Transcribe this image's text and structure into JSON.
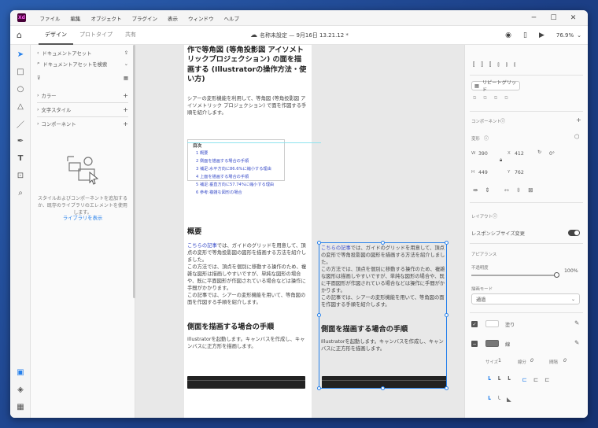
{
  "menubar": {
    "logo": "Xd",
    "items": [
      "ファイル",
      "編集",
      "オブジェクト",
      "プラグイン",
      "表示",
      "ウィンドウ",
      "ヘルプ"
    ],
    "minimize": "─",
    "maximize": "☐",
    "close": "✕"
  },
  "toolbar": {
    "tabs": [
      "デザイン",
      "プロトタイプ",
      "共有"
    ],
    "active_tab": "デザイン",
    "doc_title": "名称未設定 — 9月16日 13.21.12 *",
    "zoom": "76.9%"
  },
  "assets": {
    "title": "ドキュメントアセット",
    "search_placeholder": "ドキュメントアセットを検索",
    "sections": [
      {
        "label": "カラー",
        "add": "+"
      },
      {
        "label": "文字スタイル",
        "add": "+"
      },
      {
        "label": "コンポーネント",
        "add": "+"
      }
    ],
    "hint": "スタイルおよびコンポーネントを追加するか、既存のライブラリのエレメントを使用します。",
    "library_button": "ライブラリを表示"
  },
  "article_left": {
    "title": "シアーの変形機能を利用した変形操作で等角図 (等角投影図 アイソメトリックプロジェクション) の面を描画する (Illustratorの操作方法・使い方)",
    "intro": "シアーの変形機能を利用して、等角図 (等角投影図 アイソメトリック プロジェクション) で面を作図する手順を紹介します。",
    "toc_title": "目次",
    "toc": [
      "1 概要",
      "2 側面を描画する場合の手順",
      "3 補足:水平方向に86.6%に縮小する理由",
      "4 上面を描画する場合の手順",
      "5 補足:垂直方向に57.74%に縮小する理由",
      "6 参考:複雑な図形の場合"
    ],
    "h_overview": "概要",
    "link": "こちらの記事",
    "p1": "では、ガイドのグリッドを用意して、頂点の変形で等角投影図の図形を描画する方法を紹介しました。",
    "p2": "この方法では、頂点を個別に移動する操作のため、複雑な図形は描画しやすいですが、単純な図形の場合や、既に平面図形が作図されている場合などは操作に手間がかかります。",
    "p3": "この記事では、シアーの変形機能を用いて、等角図の面を作図する手順を紹介します。",
    "h_side": "側面を描画する場合の手順",
    "p4": "Illustratorを起動します。キャンバスを作成し、キャンバスに正方形を描画します。"
  },
  "article_right": {
    "link": "こちらの記事",
    "p1": "では、ガイドのグリッドを用意して、頂点の変形で等角投影図の図形を描画する方法を紹介しました。",
    "p2": "この方法では、頂点を個別に移動する操作のため、複雑な図形は描画しやすいですが、単純な図形の場合や、既に平面図形が作図されている場合などは操作に手間がかかります。",
    "p3": "この記事では、シアーの変形機能を用いて、等角図の面を作図する手順を紹介します。",
    "h_side": "側面を描画する場合の手順",
    "p4": "Illustratorを起動します。キャンバスを作成し、キャンバスに正方形を描画します。"
  },
  "props": {
    "repeat_grid": "リピートグリッド",
    "component_label": "コンポーネント",
    "component_add": "+",
    "transform_label": "変形",
    "w_label": "W",
    "w": "390",
    "x_label": "X",
    "x": "412",
    "rot": "0°",
    "h_label": "H",
    "h": "449",
    "y_label": "Y",
    "y": "762",
    "layout_label": "レイアウト",
    "responsive": "レスポンシブサイズ変更",
    "appearance_label": "アピアランス",
    "opacity_label": "不透明度",
    "opacity": "100%",
    "opacity_value": 1.0,
    "blend_label": "描画モード",
    "blend": "通過",
    "fill_label": "塗り",
    "stroke_label": "線",
    "size_label": "サイズ",
    "size": "1",
    "gap_label": "線分",
    "gap": "0",
    "interval_label": "間隔",
    "interval": "0"
  },
  "colors": {
    "accent": "#2680eb",
    "link": "#3c4fc9",
    "xd_logo_bg": "#470137",
    "xd_logo_fg": "#ff61f6"
  }
}
